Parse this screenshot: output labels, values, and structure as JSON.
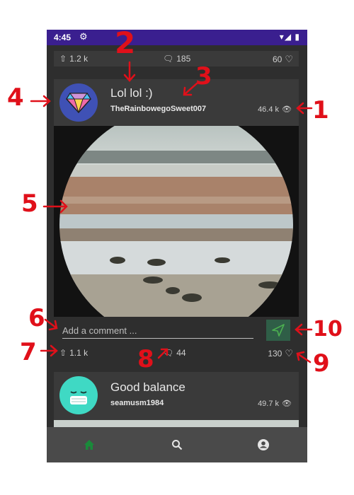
{
  "status_bar": {
    "time": "4:45",
    "gear_icon": "gear-icon",
    "right_icons": "wifi-signal-battery"
  },
  "top_stats": {
    "upvotes": "1.2 k",
    "comments": "185",
    "likes": "60"
  },
  "post1": {
    "title": "Lol lol :)",
    "author": "TheRainbowegoSweet007",
    "views": "46.4 k",
    "avatar_icon": "diamond-icon",
    "avatar_bg": "#3f51b5"
  },
  "comment": {
    "placeholder": "Add a comment ..."
  },
  "post1_stats": {
    "upvotes": "1.1 k",
    "comments": "44",
    "likes": "130"
  },
  "post2": {
    "title": "Good balance",
    "author": "seamusm1984",
    "views": "49.7 k",
    "avatar_icon": "face-mask-icon",
    "avatar_bg": "#3fd9c4"
  },
  "nav": {
    "home_icon": "home-icon",
    "search_icon": "search-icon",
    "account_icon": "account-icon",
    "active_color": "#1a8a3a"
  },
  "annotations": [
    "1",
    "2",
    "3",
    "4",
    "5",
    "6",
    "7",
    "8",
    "9",
    "10"
  ],
  "colors": {
    "accent": "#3a1f8f",
    "send": "#2f5e47",
    "annotation": "#e0101a"
  }
}
